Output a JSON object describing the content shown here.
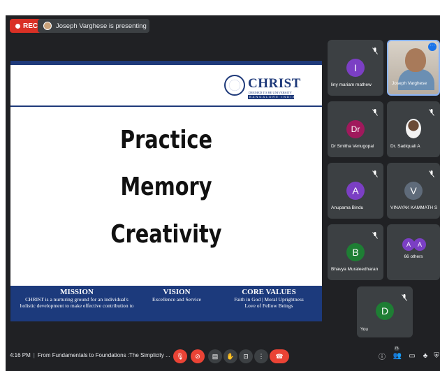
{
  "topbar": {
    "rec_label": "REC",
    "presenting_text": "Joseph Varghese is presenting"
  },
  "slide": {
    "logo_name": "CHRIST",
    "logo_sub": "DEEMED TO BE UNIVERSITY",
    "logo_city": "BANGALORE INDIA",
    "words": [
      "Practice",
      "Memory",
      "Creativity"
    ],
    "footer": {
      "mission_title": "MISSION",
      "mission_text": "CHRIST is a nurturing ground for an individual's holistic development to make effective contribution to",
      "vision_title": "VISION",
      "vision_text": "Excellence and Service",
      "core_title": "CORE VALUES",
      "core_line1": "Faith in God | Moral Uprightness",
      "core_line2": "Love of Fellow Beings"
    }
  },
  "participants": [
    {
      "name": "liny mariam mathew",
      "initial": "I",
      "color": "#7b3fc4"
    },
    {
      "name": "Joseph Varghese",
      "initial": "",
      "color": "#b7ada0"
    },
    {
      "name": "Dr Smitha Venugopal",
      "initial": "Dr",
      "color": "#a0195c"
    },
    {
      "name": "Dr. Sadiquali A",
      "initial": "",
      "color": "#202124"
    },
    {
      "name": "Anupama Bindu",
      "initial": "A",
      "color": "#7b3fc4"
    },
    {
      "name": "VINAYAK KAMMATH S",
      "initial": "V",
      "color": "#5f6b7a"
    },
    {
      "name": "Bhavya Muraleedharan",
      "initial": "B",
      "color": "#1e7e34"
    },
    {
      "name": "66 others",
      "initial": "A",
      "color": "#7b3fc4"
    },
    {
      "name": "You",
      "initial": "D",
      "color": "#1e7e34"
    }
  ],
  "others_avatars": [
    "A",
    "A"
  ],
  "bottombar": {
    "time": "4:16 PM",
    "meeting_title": "From Fundamentals to Foundations :The Simplicity ...",
    "people_count": "75"
  }
}
